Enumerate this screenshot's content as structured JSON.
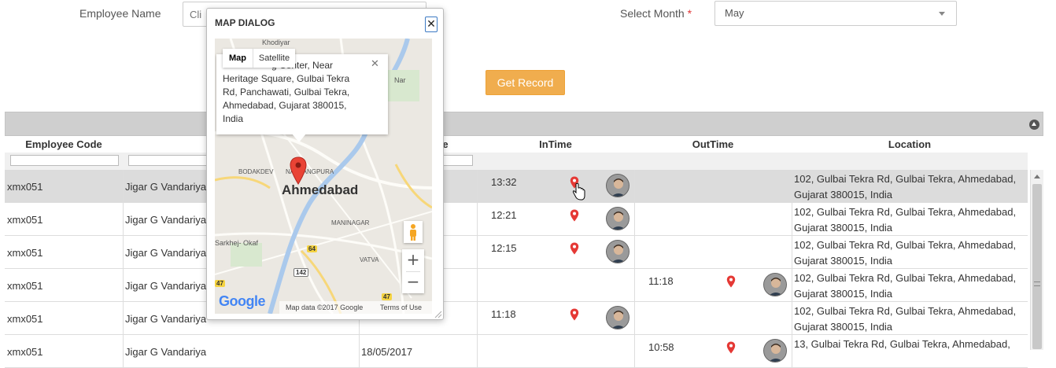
{
  "form": {
    "employee_name_label": "Employee Name",
    "employee_name_placeholder": "Cli",
    "select_month_label": "Select Month",
    "required_mark": "*",
    "month_value": "May",
    "get_record_label": "Get Record"
  },
  "grid": {
    "columns": {
      "employee_code": "Employee Code",
      "date_partial": "e",
      "intime": "InTime",
      "outtime": "OutTime",
      "location": "Location"
    },
    "rows": [
      {
        "code": "xmx051",
        "name": "Jigar G Vandariya",
        "date": "",
        "intime": "13:32",
        "outtime": "",
        "location_1": "102, Gulbai Tekra Rd, Gulbai Tekra, Ahmedabad,",
        "location_2": "Gujarat 380015, India",
        "selected": true
      },
      {
        "code": "xmx051",
        "name": "Jigar G Vandariya",
        "date": "",
        "intime": "12:21",
        "outtime": "",
        "location_1": "102, Gulbai Tekra Rd, Gulbai Tekra, Ahmedabad,",
        "location_2": "Gujarat 380015, India",
        "selected": false
      },
      {
        "code": "xmx051",
        "name": "Jigar G Vandariya",
        "date": "",
        "intime": "12:15",
        "outtime": "",
        "location_1": "102, Gulbai Tekra Rd, Gulbai Tekra, Ahmedabad,",
        "location_2": "Gujarat 380015, India",
        "selected": false
      },
      {
        "code": "xmx051",
        "name": "Jigar G Vandariya",
        "date": "",
        "intime": "",
        "outtime": "11:18",
        "location_1": "102, Gulbai Tekra Rd, Gulbai Tekra, Ahmedabad,",
        "location_2": "Gujarat 380015, India",
        "selected": false
      },
      {
        "code": "xmx051",
        "name": "Jigar G Vandariya",
        "date": "",
        "intime": "11:18",
        "outtime": "",
        "location_1": "102, Gulbai Tekra Rd, Gulbai Tekra, Ahmedabad,",
        "location_2": "Gujarat 380015, India",
        "selected": false
      },
      {
        "code": "xmx051",
        "name": "Jigar G Vandariya",
        "date": "18/05/2017",
        "intime": "",
        "outtime": "10:58",
        "location_1": "13, Gulbai Tekra Rd, Gulbai Tekra, Ahmedabad,",
        "location_2": "",
        "selected": false
      }
    ]
  },
  "dialog": {
    "title": "MAP DIALOG",
    "close_glyph": "✕",
    "map_type_map": "Map",
    "map_type_satellite": "Satellite",
    "info_lines": [
      "g Center, Near",
      "Heritage Square, Gulbai Tekra",
      "Rd, Panchawati, Gulbai Tekra,",
      "Ahmedabad, Gujarat 380015,",
      "India"
    ],
    "info_close_glyph": "✕",
    "city_label": "Ahmedabad",
    "labels": {
      "khodiyar": "Khodiyar",
      "bodakdev": "BODAKDEV",
      "navrangpura": "NAVRANGPURA",
      "maninagar": "MANINAGAR",
      "sarkhej": "Sarkhej- Okaf",
      "vatva": "VATVA",
      "nar": "Nar"
    },
    "shields": {
      "s64": "64",
      "s142": "142",
      "s47a": "47",
      "s47b": "47",
      "s147": "147"
    },
    "zoom_in": "+",
    "zoom_out": "−",
    "google": "Google",
    "map_data": "Map data ©2017 Google",
    "terms": "Terms of Use"
  },
  "icons": {
    "pin_color": "#e53935",
    "accent_button": "#f0ad4e"
  }
}
